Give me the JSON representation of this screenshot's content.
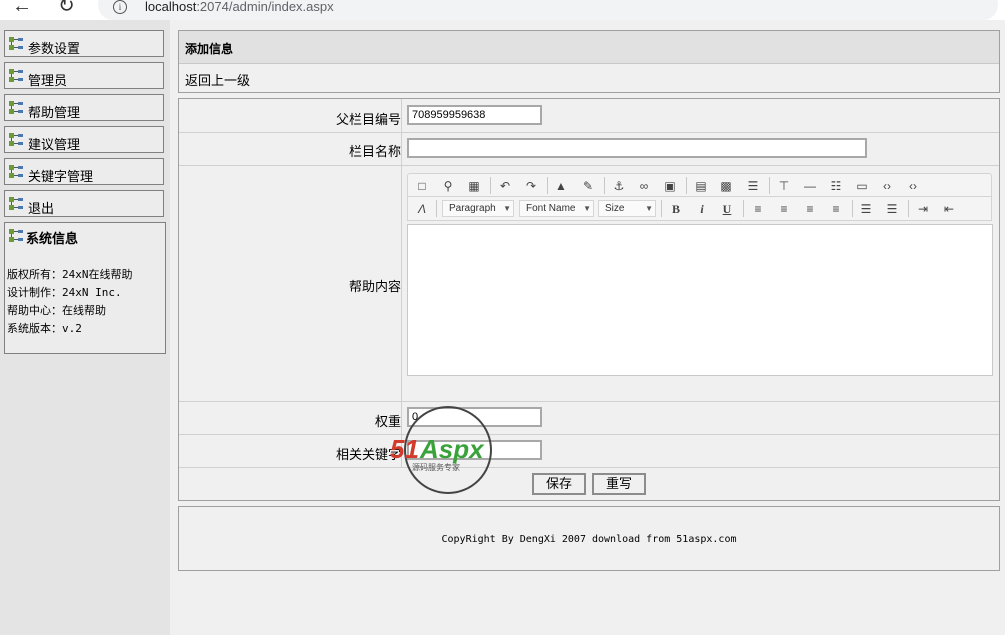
{
  "browser": {
    "url_host": "localhost",
    "url_path": ":2074/admin/index.aspx"
  },
  "sidebar": {
    "items": [
      {
        "label": "参数设置"
      },
      {
        "label": "管理员"
      },
      {
        "label": "帮助管理"
      },
      {
        "label": "建议管理"
      },
      {
        "label": "关键字管理"
      },
      {
        "label": "退出"
      }
    ],
    "system": {
      "title": "系统信息",
      "lines": [
        "版权所有：24xN在线帮助",
        "设计制作：24xN Inc.",
        "帮助中心：在线帮助",
        "系统版本：v.2"
      ]
    }
  },
  "header": {
    "title": "添加信息",
    "back_link": "返回上一级"
  },
  "form": {
    "parent_id_label": "父栏目编号",
    "parent_id_value": "708959959638",
    "name_label": "栏目名称",
    "name_value": "",
    "content_label": "帮助内容",
    "weight_label": "权重",
    "weight_value": "0",
    "keywords_label": "相关关键字",
    "keywords_value": "",
    "save_label": "保存",
    "reset_label": "重写"
  },
  "editor": {
    "format_select": "Paragraph",
    "font_select": "Font Name",
    "size_select": "Size",
    "bold": "B",
    "italic": "i",
    "underline": "U"
  },
  "footer": {
    "copyright": "CopyRight By DengXi 2007 download from 51aspx.com"
  },
  "watermark": {
    "brand_red": "51",
    "brand_green": "Aspx",
    "tagline": "源码服务专家"
  }
}
